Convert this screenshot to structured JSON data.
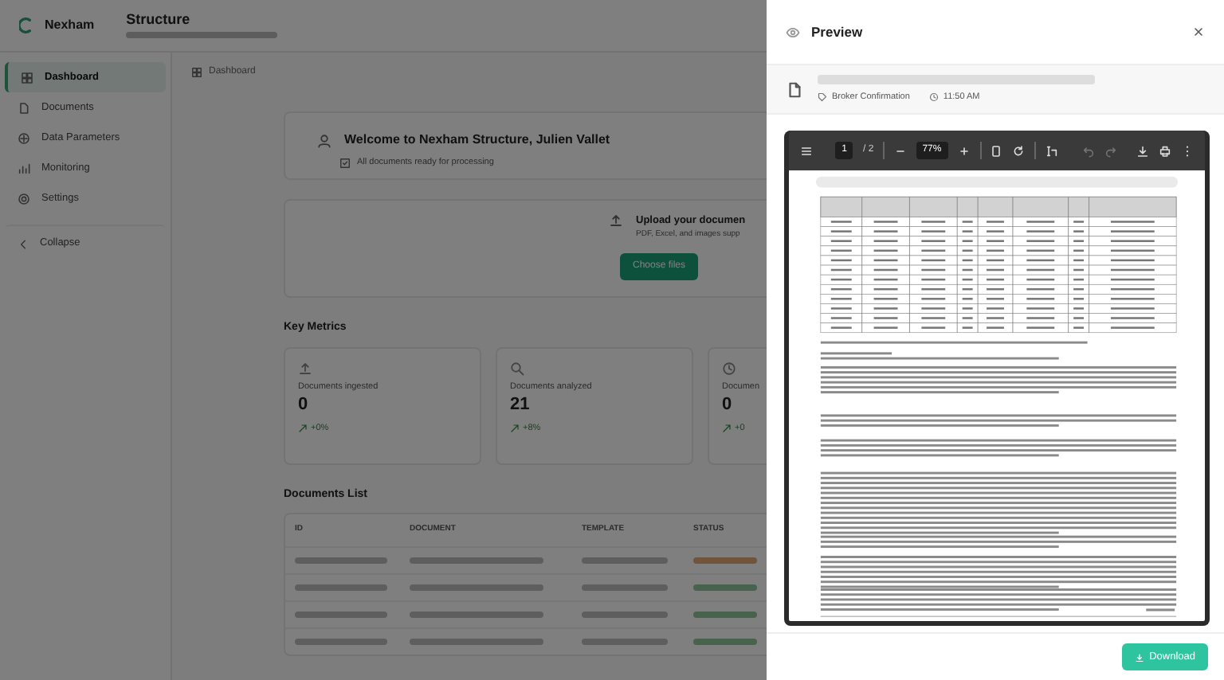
{
  "app": {
    "brand": "Nexham",
    "title": "Structure"
  },
  "sidebar": {
    "items": [
      {
        "label": "Dashboard",
        "selected": true
      },
      {
        "label": "Documents",
        "selected": false
      },
      {
        "label": "Data Parameters",
        "selected": false
      },
      {
        "label": "Monitoring",
        "selected": false
      },
      {
        "label": "Settings",
        "selected": false
      }
    ],
    "collapse": "Collapse"
  },
  "breadcrumb": "Dashboard",
  "welcome": {
    "title": "Welcome to Nexham Structure, Julien Vallet",
    "subtitle": "All documents ready for processing"
  },
  "upload": {
    "title": "Upload your documen",
    "subtitle": "PDF, Excel, and images supp",
    "button": "Choose files"
  },
  "key_metrics": {
    "title": "Key Metrics",
    "cards": [
      {
        "label": "Documents ingested",
        "value": "0",
        "change": "+0%"
      },
      {
        "label": "Documents analyzed",
        "value": "21",
        "change": "+8%"
      },
      {
        "label": "Documen",
        "value": "0",
        "change": "+0"
      }
    ]
  },
  "documents_list": {
    "title": "Documents List",
    "columns": [
      "ID",
      "DOCUMENT",
      "TEMPLATE",
      "STATUS"
    ]
  },
  "preview": {
    "title": "Preview",
    "file": {
      "tag": "Broker Confirmation",
      "time": "11:50 AM"
    },
    "viewer": {
      "page": "1",
      "page_count": "/ 2",
      "zoom": "77%",
      "undo_disabled": true,
      "redo_disabled": true
    },
    "download": "Download"
  }
}
